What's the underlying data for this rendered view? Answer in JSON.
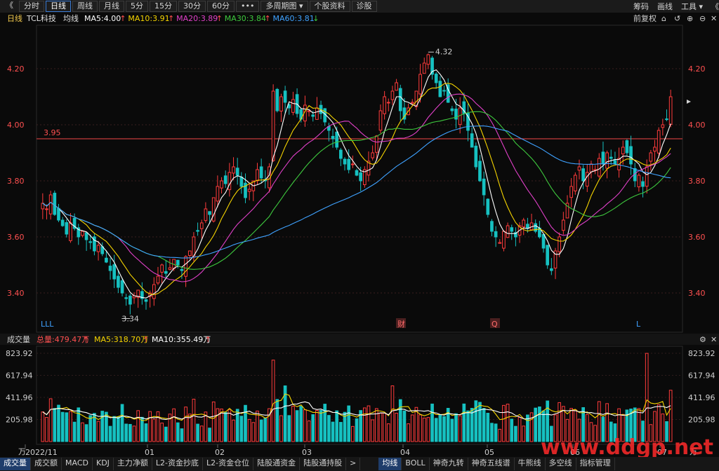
{
  "toolbar": {
    "left_items": [
      {
        "label": "《"
      },
      {
        "label": "分时"
      },
      {
        "label": "日线",
        "active": true
      },
      {
        "label": "周线"
      },
      {
        "label": "月线"
      },
      {
        "label": "5分"
      },
      {
        "label": "15分"
      },
      {
        "label": "30分"
      },
      {
        "label": "60分"
      },
      {
        "label": "•••"
      },
      {
        "label": "多周期图 ▾"
      },
      {
        "label": "个股资料"
      },
      {
        "label": "诊股"
      }
    ],
    "right_items": [
      "筹码",
      "画线",
      "工具 ▾",
      "《"
    ]
  },
  "main_pane": {
    "period": "日线",
    "stock_name": "TCL科技",
    "indicator": "均线",
    "ma_labels": [
      {
        "text": "MA5:4.00",
        "arrow": "↑",
        "color": "#ffffff"
      },
      {
        "text": "MA10:3.91",
        "arrow": "↑",
        "color": "#f5d400"
      },
      {
        "text": "MA20:3.89",
        "arrow": "↑",
        "color": "#e040c8"
      },
      {
        "text": "MA30:3.84",
        "arrow": "↑",
        "color": "#3ec93e"
      },
      {
        "text": "MA60:3.81",
        "arrow": "↓",
        "color": "#3fa2ff"
      }
    ],
    "adjust_label": "前复权",
    "price_ticks": [
      "4.20",
      "4.00",
      "3.80",
      "3.60",
      "3.40"
    ],
    "ref_line_label": "3.95",
    "high_label": "4.32",
    "low_label": "3.34",
    "markers": [
      "LLL",
      "财",
      "Q",
      "L"
    ]
  },
  "volume_pane": {
    "title": "成交量",
    "total": "总量:479.47万",
    "total_arrow": "↑",
    "ma5": "MA5:318.70万",
    "ma5_arrow": "↑",
    "ma10": "MA10:355.49万",
    "ma10_arrow": "↑",
    "ticks": [
      "823.92",
      "617.94",
      "411.96",
      "205.98"
    ],
    "unit": "万"
  },
  "x_axis_labels": [
    "2022/11",
    "01",
    "02",
    "03",
    "04",
    "05",
    "06",
    "07"
  ],
  "bottom_tabs_left": [
    "成交量",
    "成交额",
    "MACD",
    "KDJ",
    "主力净额",
    "L2-资金抄底",
    "L2-资金仓位",
    "陆股通资金",
    "陆股通持股",
    ">"
  ],
  "bottom_tabs_right": [
    "均线",
    "BOLL",
    "神奇九转",
    "神奇五线谱",
    "牛熊线",
    "多空线",
    "指标管理"
  ],
  "watermark": "www.ddgp.net",
  "chart_data": {
    "type": "candlestick",
    "y_range": [
      3.32,
      4.34
    ],
    "volume_range": [
      0,
      823.92
    ],
    "reference_price": 3.95,
    "series_closes": [
      3.72,
      3.7,
      3.75,
      3.68,
      3.66,
      3.64,
      3.61,
      3.65,
      3.63,
      3.6,
      3.62,
      3.59,
      3.58,
      3.55,
      3.57,
      3.54,
      3.51,
      3.48,
      3.45,
      3.42,
      3.4,
      3.38,
      3.36,
      3.39,
      3.41,
      3.38,
      3.37,
      3.4,
      3.43,
      3.46,
      3.5,
      3.47,
      3.49,
      3.52,
      3.5,
      3.48,
      3.53,
      3.55,
      3.6,
      3.62,
      3.65,
      3.7,
      3.68,
      3.74,
      3.78,
      3.8,
      3.79,
      3.83,
      3.85,
      3.82,
      3.78,
      3.74,
      3.77,
      3.8,
      3.84,
      3.81,
      3.8,
      3.85,
      4.12,
      4.05,
      4.1,
      4.08,
      4.06,
      4.09,
      4.04,
      4.02,
      4.07,
      4.05,
      4.03,
      4.06,
      4.04,
      4.01,
      3.98,
      3.95,
      3.92,
      3.88,
      3.86,
      3.84,
      3.86,
      3.82,
      3.8,
      3.84,
      3.87,
      3.9,
      3.96,
      4.05,
      4.1,
      4.08,
      4.12,
      4.15,
      4.05,
      4.02,
      4.06,
      4.08,
      4.12,
      4.18,
      4.22,
      4.25,
      4.18,
      4.15,
      4.1,
      4.12,
      4.08,
      4.05,
      4.02,
      4.06,
      4.04,
      3.98,
      3.92,
      3.85,
      3.8,
      3.75,
      3.68,
      3.62,
      3.6,
      3.58,
      3.62,
      3.64,
      3.62,
      3.6,
      3.64,
      3.66,
      3.63,
      3.65,
      3.62,
      3.6,
      3.56,
      3.5,
      3.48,
      3.55,
      3.6,
      3.66,
      3.72,
      3.78,
      3.82,
      3.85,
      3.8,
      3.83,
      3.86,
      3.84,
      3.88,
      3.86,
      3.9,
      3.88,
      3.86,
      3.88,
      3.92,
      3.9,
      3.86,
      3.8,
      3.82,
      3.78,
      3.85,
      3.9,
      3.92,
      3.98,
      4.0,
      4.02,
      4.1
    ]
  }
}
